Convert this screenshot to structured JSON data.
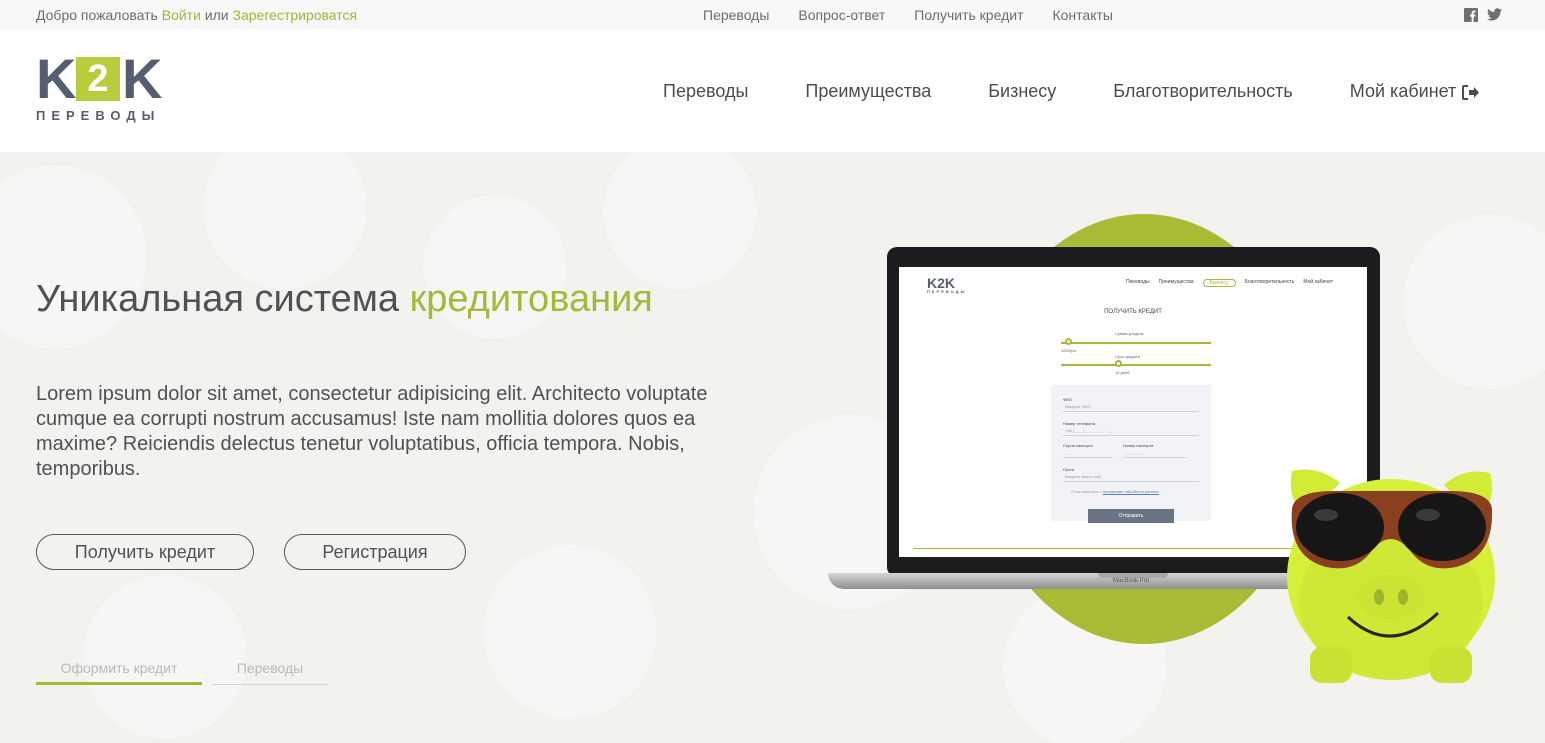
{
  "topbar": {
    "welcome": "Добро пожаловать",
    "login": "Войти",
    "or": "или",
    "register": "Зарегестрироватся",
    "links": [
      "Переводы",
      "Вопрос-ответ",
      "Получить кредит",
      "Контакты"
    ],
    "social_icons": [
      "facebook-icon",
      "twitter-icon"
    ]
  },
  "header": {
    "logo": {
      "left": "K",
      "middle": "2",
      "right": "K",
      "subtitle": "ПЕРЕВОДЫ"
    },
    "nav": [
      "Переводы",
      "Преимущества",
      "Бизнесу",
      "Благотворительность",
      "Мой кабинет"
    ],
    "cabinet_icon": "sign-out-icon"
  },
  "hero": {
    "title_part1": "Уникальная система",
    "title_part2": "кредитования",
    "description": "Lorem ipsum dolor sit amet, consectetur adipisicing elit. Architecto voluptate cumque ea corrupti nostrum accusamus! Iste nam mollitia dolores quos ea maxime? Reiciendis delectus tenetur voluptatibus, officia tempora. Nobis, temporibus.",
    "buttons": {
      "credit": "Получить кредит",
      "register": "Регистрация"
    },
    "tabs": [
      "Оформить кредит",
      "Переводы"
    ]
  },
  "laptop": {
    "brand": "MacBook Pro",
    "screen": {
      "logo": "K2K",
      "logo_sub": "ПЕРЕВОДЫ",
      "nav": [
        "Переводы",
        "Преимущества",
        "Бизнесу",
        "Благотворительность",
        "Мой кабинет"
      ],
      "heading": "ПОЛУЧИТЬ КРЕДИТ",
      "amount_label": "Сумма кредита",
      "amount_value": "1000грн",
      "term_label": "Срок кредита",
      "term_value": "15 дней",
      "fields": {
        "name_label": "ФИО",
        "name_ph": "Введите ФИО",
        "phone_label": "Номер телефона",
        "phone_ph": "+38 (_ _ _) _ _ _ - _ _ - _ _",
        "series_label": "Серия паспорта",
        "series_ph": "_ _",
        "number_label": "Номер паспорта",
        "number_ph": "_ _ _ _ _ _",
        "email_label": "Почта",
        "email_ph": "Введите ваш e-mail",
        "agree_prefix": "Я согласен(на) с",
        "agree_link": "правилами обработки данных"
      },
      "submit": "Отправить"
    }
  },
  "colors": {
    "accent": "#a4b83a",
    "logo_dark": "#555e6e",
    "logo_green": "#b8cc3c",
    "pig": "#d6f03a"
  }
}
